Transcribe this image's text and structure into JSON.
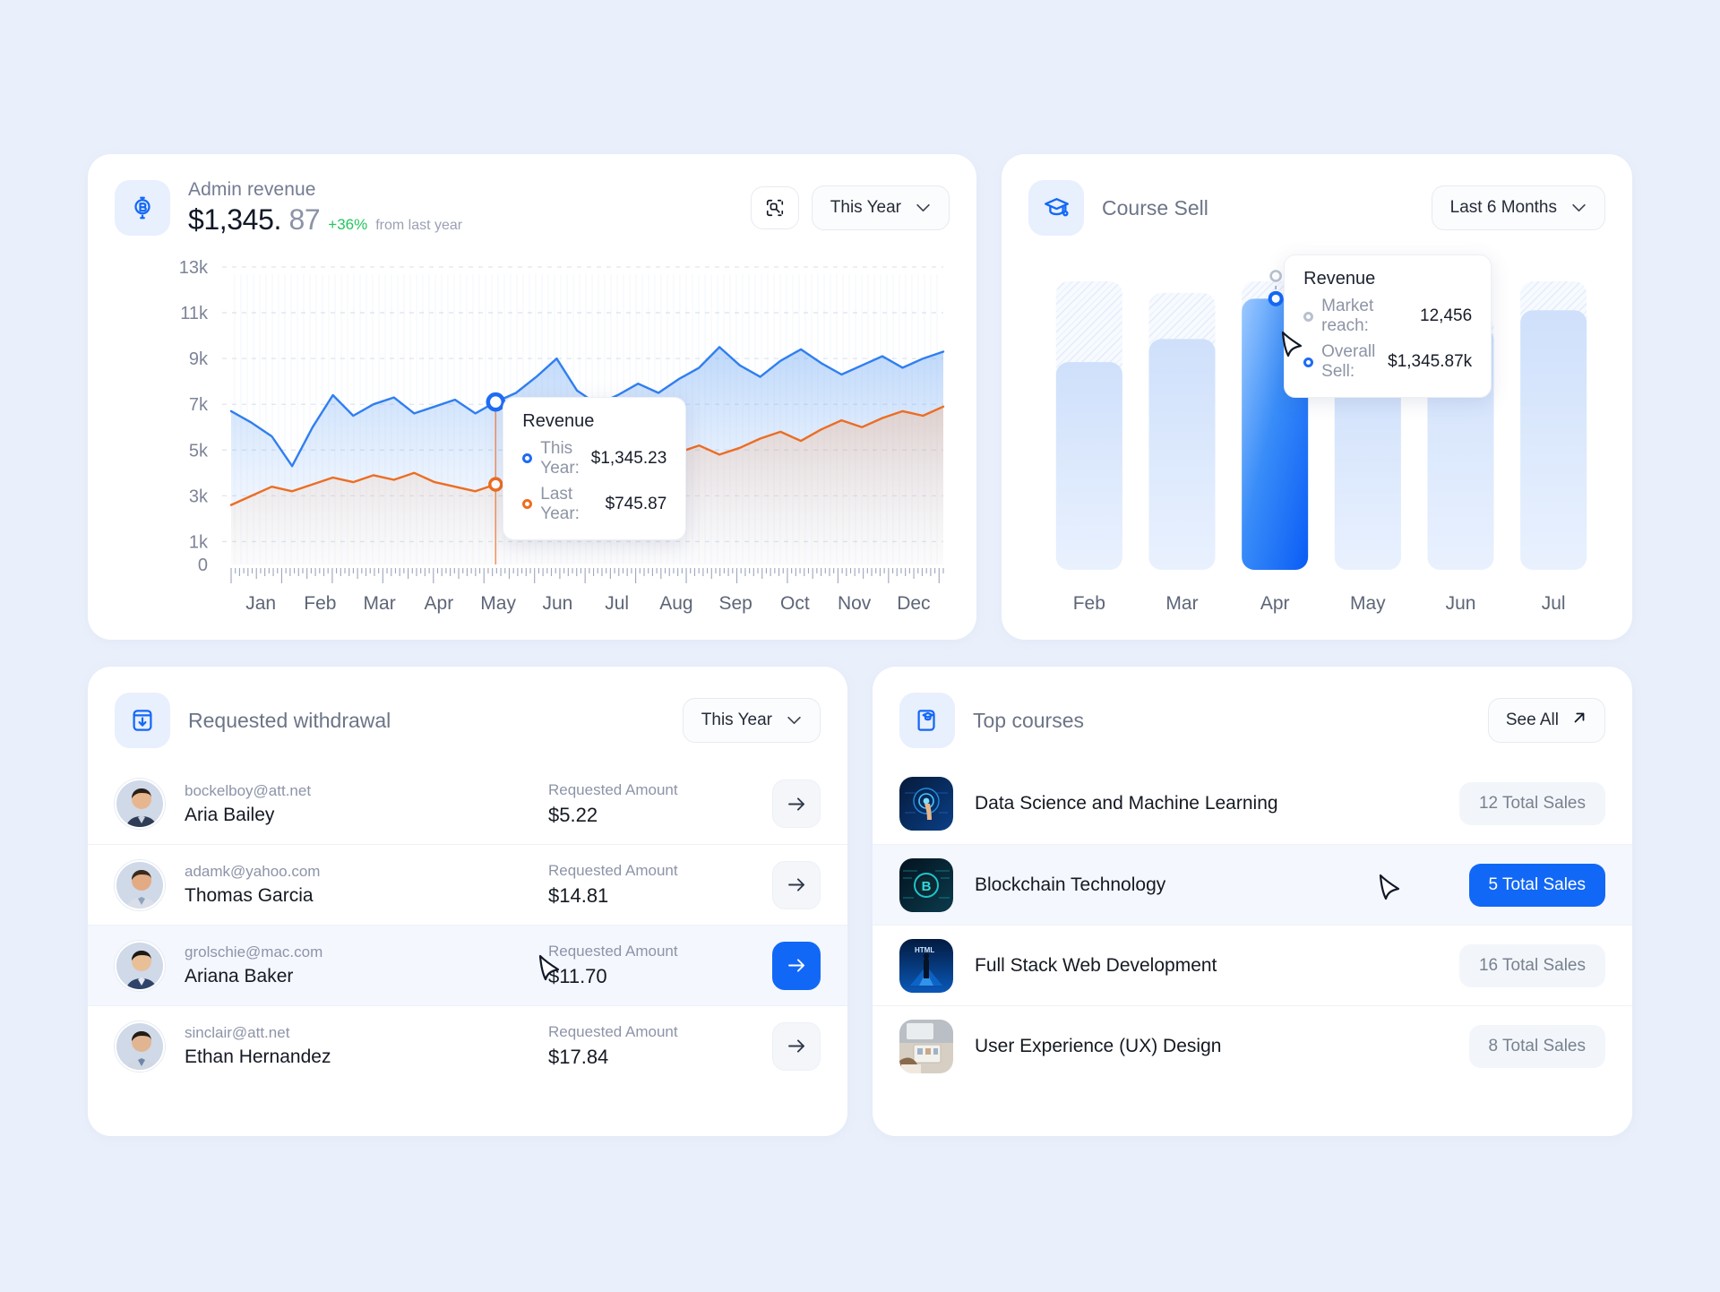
{
  "theme": {
    "bg": "#eaf0fb",
    "card": "#ffffff",
    "accent": "#1268f6",
    "green": "#22c55e",
    "orange": "#ee6c20"
  },
  "revenue_card": {
    "icon": "bitcoin-icon",
    "title": "Admin revenue",
    "value_main": "$1,345.",
    "value_cents": "87",
    "delta": "+36%",
    "delta_note": "from last year",
    "expand_icon": "expand-selection-icon",
    "period": "This Year",
    "chevron": "chevron-down-icon",
    "tooltip": {
      "title": "Revenue",
      "rows": [
        {
          "label": "This Year:",
          "value": "$1,345.23",
          "color": "#1f6bf5"
        },
        {
          "label": "Last Year:",
          "value": "$745.87",
          "color": "#ee6c20"
        }
      ]
    }
  },
  "coursesell_card": {
    "icon": "graduation-cap-icon",
    "title": "Course Sell",
    "period": "Last 6 Months",
    "chevron": "chevron-down-icon",
    "tooltip": {
      "title": "Revenue",
      "rows": [
        {
          "label": "Market reach:",
          "value": "12,456",
          "color": "#b9c0cf"
        },
        {
          "label": "Overall Sell:",
          "value": "$1,345.87k",
          "color": "#1f6bf5"
        }
      ]
    }
  },
  "withdrawal_card": {
    "icon": "withdraw-icon",
    "title": "Requested withdrawal",
    "period": "This Year",
    "chevron": "chevron-down-icon",
    "amount_label": "Requested Amount",
    "action_icon": "arrow-right-icon",
    "rows": [
      {
        "email": "bockelboy@att.net",
        "name": "Aria Bailey",
        "amount": "$5.22",
        "active": false
      },
      {
        "email": "adamk@yahoo.com",
        "name": "Thomas Garcia",
        "amount": "$14.81",
        "active": false
      },
      {
        "email": "grolschie@mac.com",
        "name": "Ariana Baker",
        "amount": "$11.70",
        "active": true
      },
      {
        "email": "sinclair@att.net",
        "name": "Ethan Hernandez",
        "amount": "$17.84",
        "active": false
      }
    ]
  },
  "topcourses_card": {
    "icon": "course-book-icon",
    "title": "Top courses",
    "see_all": "See All",
    "see_all_icon": "arrow-up-right-icon",
    "rows": [
      {
        "title": "Data Science and Machine Learning",
        "sales": "12 Total Sales",
        "active": false
      },
      {
        "title": "Blockchain Technology",
        "sales": "5 Total Sales",
        "active": true
      },
      {
        "title": "Full Stack Web Development",
        "sales": "16 Total Sales",
        "active": false
      },
      {
        "title": "User Experience (UX) Design",
        "sales": "8 Total Sales",
        "active": false
      }
    ]
  },
  "chart_data": [
    {
      "type": "area",
      "title": "Revenue",
      "xlabel": "",
      "ylabel": "",
      "ylim": [
        0,
        13000
      ],
      "ytick_labels": [
        "0",
        "1k",
        "3k",
        "5k",
        "7k",
        "9k",
        "11k",
        "13k"
      ],
      "yticks": [
        0,
        1000,
        3000,
        5000,
        7000,
        9000,
        11000,
        13000
      ],
      "categories": [
        "Jan",
        "Feb",
        "Mar",
        "Apr",
        "May",
        "Jun",
        "Jul",
        "Aug",
        "Sep",
        "Oct",
        "Nov",
        "Dec"
      ],
      "grid": true,
      "legend": "tooltip",
      "series": [
        {
          "name": "This Year",
          "color": "#2f7ef0",
          "values": [
            6700,
            6200,
            5600,
            4300,
            6000,
            7400,
            6500,
            7000,
            7300,
            6600,
            6900,
            7200,
            6600,
            7100,
            7500,
            8200,
            9000,
            7600,
            7000,
            7400,
            7900,
            7500,
            8100,
            8600,
            9500,
            8700,
            8200,
            8900,
            9400,
            8800,
            8300,
            8700,
            9100,
            8600,
            9000,
            9300
          ]
        },
        {
          "name": "Last Year",
          "color": "#ee6c20",
          "values": [
            2600,
            3000,
            3400,
            3200,
            3500,
            3800,
            3600,
            3900,
            3700,
            4000,
            3600,
            3400,
            3200,
            3500,
            3700,
            3400,
            3800,
            4100,
            3900,
            3600,
            4200,
            4500,
            4900,
            5200,
            4800,
            5100,
            5500,
            5800,
            5400,
            5900,
            6300,
            6000,
            6400,
            6700,
            6500,
            6900
          ]
        }
      ],
      "annotations": [
        {
          "series": "This Year",
          "x": "May",
          "value": "$1,345.23"
        },
        {
          "series": "Last Year",
          "x": "May",
          "value": "$745.87"
        }
      ]
    },
    {
      "type": "bar",
      "title": "Course Sell",
      "categories": [
        "Feb",
        "Mar",
        "Apr",
        "May",
        "Jun",
        "Jul"
      ],
      "xlabel": "",
      "ylabel": "",
      "ylim": [
        0,
        100
      ],
      "values": [
        72,
        80,
        94,
        71,
        84,
        90
      ],
      "capacity": [
        100,
        96,
        100,
        92,
        88,
        100
      ],
      "highlight_index": 2,
      "grid": false,
      "legend": "tooltip"
    }
  ]
}
